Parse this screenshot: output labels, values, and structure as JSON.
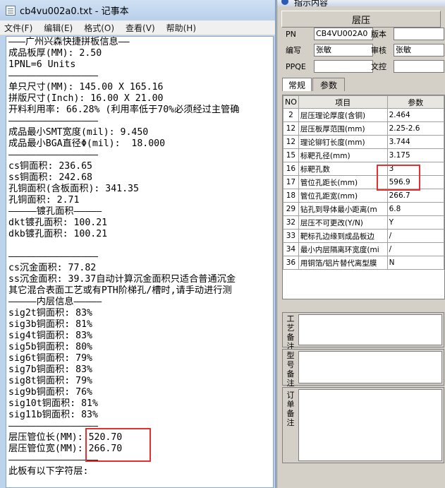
{
  "notepad": {
    "title": "cb4vu002a0.txt - 记事本",
    "menu": [
      "文件(F)",
      "编辑(E)",
      "格式(O)",
      "查看(V)",
      "帮助(H)"
    ],
    "lines": [
      "———广州兴森快捷拼板信息——",
      "成品板厚(MM): 2.50",
      "1PNL=6 Units",
      "————————————————",
      "单只尺寸(MM): 145.00 X 165.16",
      "拼版尺寸(Inch): 16.00 X 21.00",
      "开料利用率: 66.28% (利用率低于70%必须经过主管确",
      "————————————————",
      "成品最小SMT宽度(mil): 9.450",
      "成品最小BGA直径Φ(mil):  18.000",
      "————————————————",
      "cs铜面积: 236.65",
      "ss铜面积: 242.68",
      "孔铜面积(含板面积): 341.35",
      "孔铜面积: 2.71",
      "—————镀孔面积—————",
      "dkt镀孔面积: 100.21",
      "dkb镀孔面积: 100.21",
      "",
      "————————————————",
      "cs沉金面积: 77.82",
      "ss沉金面积: 39.37自动计算沉金面积只适合普通沉金",
      "其它混合表面工艺或有PTH阶梯孔/槽时,请手动进行测",
      "—————内层信息—————",
      "sig2t铜面积: 83%",
      "sig3b铜面积: 81%",
      "sig4t铜面积: 83%",
      "sig5b铜面积: 80%",
      "sig6t铜面积: 79%",
      "sig7b铜面积: 83%",
      "sig8t铜面积: 79%",
      "sig9b铜面积: 76%",
      "sig10t铜面积: 81%",
      "sig11b铜面积: 83%",
      "————————————————",
      "层压管位长(MM): 520.70",
      "层压管位宽(MM): 266.70",
      "————————————————",
      "此板有以下字符层:"
    ]
  },
  "dialog": {
    "title": "指示内容",
    "header": "层压",
    "fields": {
      "pn_label": "PN",
      "pn_value": "CB4VU002A0",
      "version_label": "版本",
      "version_value": "",
      "author_label": "编写",
      "author_value": "张敏",
      "review_label": "审核",
      "review_value": "张敏",
      "ppqe_label": "PPQE",
      "ppqe_value": "",
      "doc_label": "文控",
      "doc_value": ""
    },
    "tabs": [
      "常规",
      "参数"
    ],
    "grid_headers": [
      "NO",
      "项目",
      "参数"
    ],
    "rows": [
      {
        "no": "2",
        "item": "层压理论厚度(含铜)",
        "param": "2.464"
      },
      {
        "no": "12",
        "item": "层压板厚范围(mm)",
        "param": "2.25-2.6"
      },
      {
        "no": "12",
        "item": "理论铆钉长度(mm)",
        "param": "3.744"
      },
      {
        "no": "15",
        "item": "标靶孔径(mm)",
        "param": "3.175"
      },
      {
        "no": "16",
        "item": "标靶孔数",
        "param": "3"
      },
      {
        "no": "17",
        "item": "管位孔距长(mm)",
        "param": "596.9"
      },
      {
        "no": "18",
        "item": "管位孔距宽(mm)",
        "param": "266.7"
      },
      {
        "no": "29",
        "item": "钻孔到导体最小距离(m",
        "param": "6.8"
      },
      {
        "no": "32",
        "item": "层压不可更改(Y/N)",
        "param": "Y"
      },
      {
        "no": "33",
        "item": "靶标孔边缘到成品板边",
        "param": "/"
      },
      {
        "no": "34",
        "item": "最小内层隔离环宽度(mi",
        "param": "/"
      },
      {
        "no": "36",
        "item": "用铜箔/铝片替代离型膜",
        "param": "N"
      }
    ],
    "notes": [
      "工艺备注",
      "型号备注",
      "订单备注"
    ]
  },
  "colors": {
    "highlight": "#e53030"
  }
}
